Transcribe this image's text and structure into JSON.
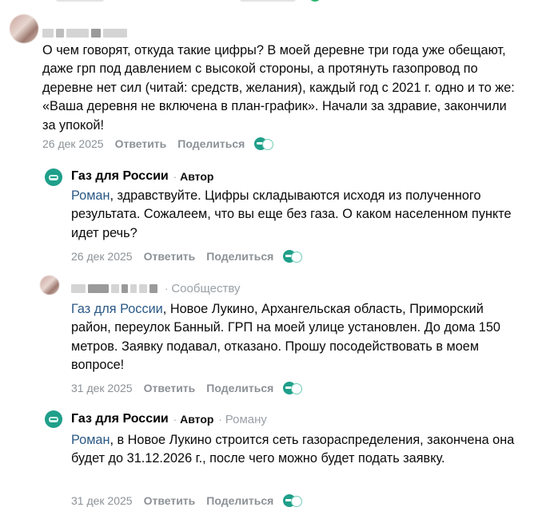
{
  "comments": [
    {
      "author_visible": false,
      "text": "О чем говорят, откуда такие цифры? В моей деревне три года уже обещают, даже грп под давлением с высокой стороны, а протянуть газопровод по деревне нет сил (читай: средств, желания), каждый год с 2021 г. одно и то же: «Ваша деревня не включена в план-график». Начали за здравие, закончили за упокой!",
      "date": "26 дек 2025",
      "reply_label": "Ответить",
      "share_label": "Поделиться"
    },
    {
      "author": "Газ для России",
      "author_tag": "Автор",
      "mention": "Роман",
      "text": ", здравствуйте. Цифры складываются исходя из полученного результата. Сожалеем, что вы еще без газа. О каком населенном пункте идет речь?",
      "date": "26 дек 2025",
      "reply_label": "Ответить",
      "share_label": "Поделиться"
    },
    {
      "author_visible": false,
      "reply_to": "Сообществу",
      "mention": "Газ для России",
      "text": ", Новое Лукино, Архангельская область, Приморский район, переулок Банный. ГРП на моей улице установлен. До дома 150 метров. Заявку подавал, отказано. Прошу посодействовать в моем вопросе!",
      "date": "31 дек 2025",
      "reply_label": "Ответить",
      "share_label": "Поделиться"
    },
    {
      "author": "Газ для России",
      "author_tag": "Автор",
      "reply_to": "Роману",
      "mention": "Роман",
      "text": ", в Новое Лукино строится сеть газораспределения, закончена она будет до 31.12.2026 г., после чего можно будет подать заявку.",
      "date": "31 дек 2025",
      "reply_label": "Ответить",
      "share_label": "Поделиться"
    }
  ],
  "separator": "·",
  "icons": {
    "avatar_blurred": "blurred-user-avatar",
    "community_avatar": "gas-logo-icon",
    "reaction": "reaction-icon"
  },
  "colors": {
    "mention": "#2a5885",
    "muted": "#8c9196",
    "brand": "#1f9f8a"
  }
}
